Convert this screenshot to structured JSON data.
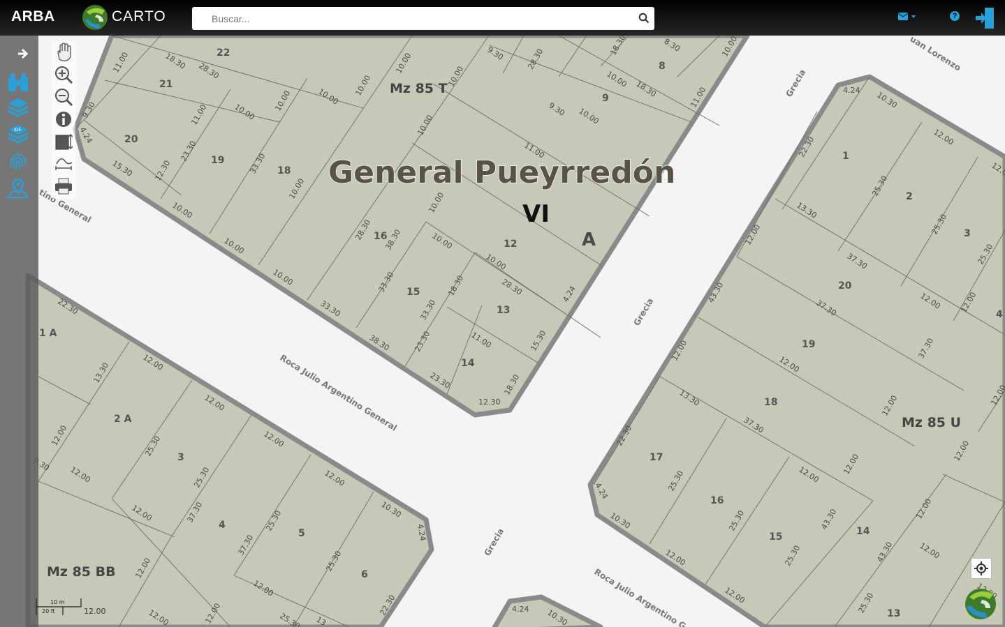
{
  "header": {
    "brand": "ARBA",
    "carto_brand": "CARTO",
    "search_placeholder": "Buscar...",
    "icons": [
      "search-icon",
      "mail-icon",
      "help-icon",
      "exit-icon"
    ]
  },
  "sidebar": {
    "icons": [
      "arrow-right-icon",
      "binoculars-icon",
      "layers-icon",
      "ide-layers-icon",
      "fingerprint-icon",
      "map-pin-icon"
    ]
  },
  "map_tools": {
    "icons": [
      "hand-pan-icon",
      "zoom-in-icon",
      "zoom-out-icon",
      "info-icon",
      "select-area-icon",
      "measure-icon",
      "print-icon"
    ]
  },
  "map": {
    "locality": "General Pueyrredón",
    "circ": "VI",
    "section": "A",
    "blocks": [
      "Mz 85 T",
      "Mz 85 U",
      "Mz 85 BB"
    ],
    "streets": {
      "grecia": "Grecia",
      "roca": "Roca Julio Argentino General",
      "roca_right": "Roca Julio Argentino G",
      "roca_left": "tino General",
      "san_lorenzo": "uan Lorenzo"
    },
    "scale_m": "10 m",
    "scale_ft": "20 ft",
    "parcels_t": [
      "22",
      "21",
      "20",
      "19",
      "18",
      "16",
      "15",
      "14",
      "13",
      "12",
      "9",
      "8"
    ],
    "parcels_u": [
      "1",
      "2",
      "3",
      "4",
      "20",
      "19",
      "18",
      "17",
      "16",
      "15",
      "14",
      "13"
    ],
    "parcels_bb": [
      "1 A",
      "2 A",
      "3",
      "4",
      "5",
      "6"
    ],
    "dims_t": [
      "18.30",
      "28.30",
      "11.00",
      "9.30",
      "4.24",
      "15.30",
      "12.30",
      "10.00",
      "10.00",
      "23.30",
      "11.00",
      "10.00",
      "10.00",
      "33.30",
      "10.00",
      "10.00",
      "10.00",
      "10.00",
      "10.00",
      "33.30",
      "10.00",
      "38.30",
      "28.30",
      "38.30",
      "10.00",
      "33.30",
      "33.30",
      "10.00",
      "10.00",
      "10.00",
      "28.30",
      "18.30",
      "11.00",
      "23.30",
      "23.30",
      "12.30",
      "18.30",
      "15.30",
      "4.24",
      "9.30",
      "11.00",
      "10.00",
      "10.00",
      "18.30",
      "11.00",
      "9.30",
      "28.30",
      "18.30",
      "8.30",
      "10.00"
    ],
    "dims_u": [
      "4.24",
      "10.30",
      "12.00",
      "22.30",
      "13.30",
      "25.30",
      "12.00",
      "25.30",
      "12.0",
      "37.30",
      "12.00",
      "25.30",
      "12.00",
      "37.30",
      "43.30",
      "12.00",
      "37.30",
      "12.00",
      "12.00",
      "37.30",
      "12.00",
      "13.30",
      "12.00",
      "22.30",
      "12.00",
      "25.30",
      "12.00",
      "25.30",
      "12.00",
      "4.24",
      "10.30",
      "12.00",
      "43.30",
      "25.30",
      "12.00",
      "43.30",
      "12.00",
      "25.30",
      "12.00"
    ],
    "dims_bb": [
      "22.30",
      "13.30",
      "12.00",
      "12.00",
      "12.00",
      "12.00",
      "12.00",
      "12.00",
      "12.00",
      "25.30",
      "25.30",
      "37.30",
      "12.00",
      "37.30",
      "25.30",
      "25.30",
      "12.00",
      "10.30",
      "4.24",
      "22.30",
      "12.00",
      "12.00",
      "12.00",
      "25.30",
      "13",
      "9.30",
      "12.00",
      "4.24",
      "10.30"
    ]
  }
}
